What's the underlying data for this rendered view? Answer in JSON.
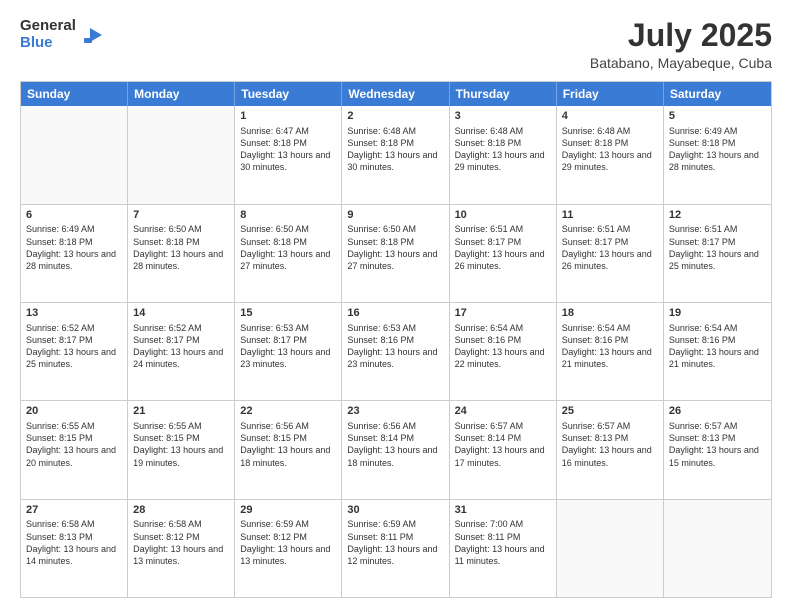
{
  "logo": {
    "general": "General",
    "blue": "Blue",
    "icon": "▶"
  },
  "header": {
    "month_year": "July 2025",
    "location": "Batabano, Mayabeque, Cuba"
  },
  "weekdays": [
    "Sunday",
    "Monday",
    "Tuesday",
    "Wednesday",
    "Thursday",
    "Friday",
    "Saturday"
  ],
  "weeks": [
    [
      {
        "day": "",
        "info": ""
      },
      {
        "day": "",
        "info": ""
      },
      {
        "day": "1",
        "info": "Sunrise: 6:47 AM\nSunset: 8:18 PM\nDaylight: 13 hours and 30 minutes."
      },
      {
        "day": "2",
        "info": "Sunrise: 6:48 AM\nSunset: 8:18 PM\nDaylight: 13 hours and 30 minutes."
      },
      {
        "day": "3",
        "info": "Sunrise: 6:48 AM\nSunset: 8:18 PM\nDaylight: 13 hours and 29 minutes."
      },
      {
        "day": "4",
        "info": "Sunrise: 6:48 AM\nSunset: 8:18 PM\nDaylight: 13 hours and 29 minutes."
      },
      {
        "day": "5",
        "info": "Sunrise: 6:49 AM\nSunset: 8:18 PM\nDaylight: 13 hours and 28 minutes."
      }
    ],
    [
      {
        "day": "6",
        "info": "Sunrise: 6:49 AM\nSunset: 8:18 PM\nDaylight: 13 hours and 28 minutes."
      },
      {
        "day": "7",
        "info": "Sunrise: 6:50 AM\nSunset: 8:18 PM\nDaylight: 13 hours and 28 minutes."
      },
      {
        "day": "8",
        "info": "Sunrise: 6:50 AM\nSunset: 8:18 PM\nDaylight: 13 hours and 27 minutes."
      },
      {
        "day": "9",
        "info": "Sunrise: 6:50 AM\nSunset: 8:18 PM\nDaylight: 13 hours and 27 minutes."
      },
      {
        "day": "10",
        "info": "Sunrise: 6:51 AM\nSunset: 8:17 PM\nDaylight: 13 hours and 26 minutes."
      },
      {
        "day": "11",
        "info": "Sunrise: 6:51 AM\nSunset: 8:17 PM\nDaylight: 13 hours and 26 minutes."
      },
      {
        "day": "12",
        "info": "Sunrise: 6:51 AM\nSunset: 8:17 PM\nDaylight: 13 hours and 25 minutes."
      }
    ],
    [
      {
        "day": "13",
        "info": "Sunrise: 6:52 AM\nSunset: 8:17 PM\nDaylight: 13 hours and 25 minutes."
      },
      {
        "day": "14",
        "info": "Sunrise: 6:52 AM\nSunset: 8:17 PM\nDaylight: 13 hours and 24 minutes."
      },
      {
        "day": "15",
        "info": "Sunrise: 6:53 AM\nSunset: 8:17 PM\nDaylight: 13 hours and 23 minutes."
      },
      {
        "day": "16",
        "info": "Sunrise: 6:53 AM\nSunset: 8:16 PM\nDaylight: 13 hours and 23 minutes."
      },
      {
        "day": "17",
        "info": "Sunrise: 6:54 AM\nSunset: 8:16 PM\nDaylight: 13 hours and 22 minutes."
      },
      {
        "day": "18",
        "info": "Sunrise: 6:54 AM\nSunset: 8:16 PM\nDaylight: 13 hours and 21 minutes."
      },
      {
        "day": "19",
        "info": "Sunrise: 6:54 AM\nSunset: 8:16 PM\nDaylight: 13 hours and 21 minutes."
      }
    ],
    [
      {
        "day": "20",
        "info": "Sunrise: 6:55 AM\nSunset: 8:15 PM\nDaylight: 13 hours and 20 minutes."
      },
      {
        "day": "21",
        "info": "Sunrise: 6:55 AM\nSunset: 8:15 PM\nDaylight: 13 hours and 19 minutes."
      },
      {
        "day": "22",
        "info": "Sunrise: 6:56 AM\nSunset: 8:15 PM\nDaylight: 13 hours and 18 minutes."
      },
      {
        "day": "23",
        "info": "Sunrise: 6:56 AM\nSunset: 8:14 PM\nDaylight: 13 hours and 18 minutes."
      },
      {
        "day": "24",
        "info": "Sunrise: 6:57 AM\nSunset: 8:14 PM\nDaylight: 13 hours and 17 minutes."
      },
      {
        "day": "25",
        "info": "Sunrise: 6:57 AM\nSunset: 8:13 PM\nDaylight: 13 hours and 16 minutes."
      },
      {
        "day": "26",
        "info": "Sunrise: 6:57 AM\nSunset: 8:13 PM\nDaylight: 13 hours and 15 minutes."
      }
    ],
    [
      {
        "day": "27",
        "info": "Sunrise: 6:58 AM\nSunset: 8:13 PM\nDaylight: 13 hours and 14 minutes."
      },
      {
        "day": "28",
        "info": "Sunrise: 6:58 AM\nSunset: 8:12 PM\nDaylight: 13 hours and 13 minutes."
      },
      {
        "day": "29",
        "info": "Sunrise: 6:59 AM\nSunset: 8:12 PM\nDaylight: 13 hours and 13 minutes."
      },
      {
        "day": "30",
        "info": "Sunrise: 6:59 AM\nSunset: 8:11 PM\nDaylight: 13 hours and 12 minutes."
      },
      {
        "day": "31",
        "info": "Sunrise: 7:00 AM\nSunset: 8:11 PM\nDaylight: 13 hours and 11 minutes."
      },
      {
        "day": "",
        "info": ""
      },
      {
        "day": "",
        "info": ""
      }
    ]
  ]
}
